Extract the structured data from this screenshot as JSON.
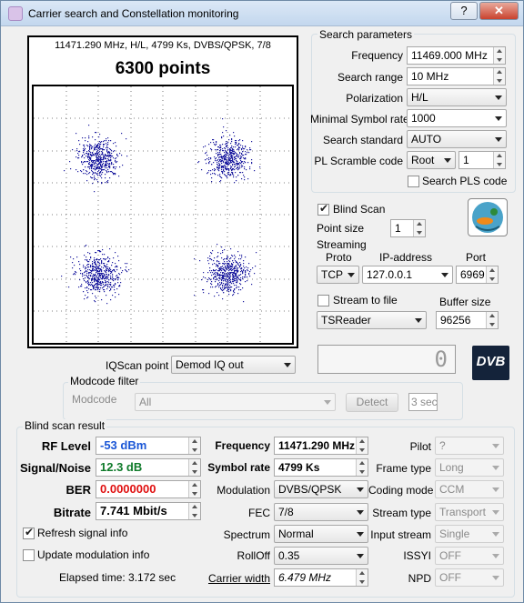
{
  "window": {
    "title": "Carrier search and Constellation monitoring",
    "help_label": "?",
    "close_label": "✕"
  },
  "plot": {
    "header": "11471.290 MHz, H/L, 4799 Ks, DVBS/QPSK, 7/8",
    "points_label": "6300 points",
    "dot_color": "#1e1ea0"
  },
  "search_params": {
    "title": "Search parameters",
    "frequency_label": "Frequency",
    "frequency_value": "11469.000 MHz",
    "range_label": "Search range",
    "range_value": "10 MHz",
    "polarization_label": "Polarization",
    "polarization_value": "H/L",
    "min_sr_label": "Minimal Symbol rate",
    "min_sr_value": "1000",
    "standard_label": "Search standard",
    "standard_value": "AUTO",
    "pl_label": "PL Scramble code",
    "pl_type": "Root",
    "pl_value": "1",
    "search_pls_label": "Search PLS code"
  },
  "blind": {
    "blind_scan_label": "Blind Scan",
    "point_size_label": "Point size",
    "point_size_value": "1"
  },
  "streaming": {
    "title": "Streaming",
    "proto_label": "Proto",
    "ip_label": "IP-address",
    "port_label": "Port",
    "proto_value": "TCP",
    "ip_value": "127.0.0.1",
    "port_value": "6969",
    "stream_to_file_label": "Stream to file",
    "buffer_label": "Buffer size",
    "reader_value": "TSReader",
    "buffer_value": "96256"
  },
  "iq": {
    "iq_label": "IQScan point",
    "iq_value": "Demod IQ out",
    "counter_value": "0",
    "dvb_logo": "DVB"
  },
  "modcode": {
    "title": "Modcode filter",
    "label": "Modcode",
    "value": "All",
    "detect_label": "Detect",
    "sec_value": "3 sec"
  },
  "result": {
    "title": "Blind scan result",
    "rf_label": "RF Level",
    "rf_value": "-53 dBm",
    "sn_label": "Signal/Noise",
    "sn_value": "12.3 dB",
    "ber_label": "BER",
    "ber_value": "0.0000000",
    "bitrate_label": "Bitrate",
    "bitrate_value": "7.741 Mbit/s",
    "freq_label": "Frequency",
    "freq_value": "11471.290 MHz",
    "sr_label": "Symbol rate",
    "sr_value": "4799 Ks",
    "mod_label": "Modulation",
    "mod_value": "DVBS/QPSK",
    "fec_label": "FEC",
    "fec_value": "7/8",
    "spectrum_label": "Spectrum",
    "spectrum_value": "Normal",
    "rolloff_label": "RollOff",
    "rolloff_value": "0.35",
    "cw_label": "Carrier width",
    "cw_value": "6.479 MHz",
    "pilot_label": "Pilot",
    "pilot_value": "?",
    "frame_label": "Frame type",
    "frame_value": "Long",
    "coding_label": "Coding mode",
    "coding_value": "CCM",
    "stream_label": "Stream type",
    "stream_value": "Transport",
    "input_label": "Input stream",
    "input_value": "Single",
    "issyi_label": "ISSYI",
    "issyi_value": "OFF",
    "npd_label": "NPD",
    "npd_value": "OFF",
    "refresh_label": "Refresh signal info",
    "update_label": "Update modulation info",
    "elapsed": "Elapsed time: 3.172 sec",
    "colors": {
      "rf": "#1a56d6",
      "sn": "#0f7a2a",
      "ber": "#e01010"
    }
  }
}
